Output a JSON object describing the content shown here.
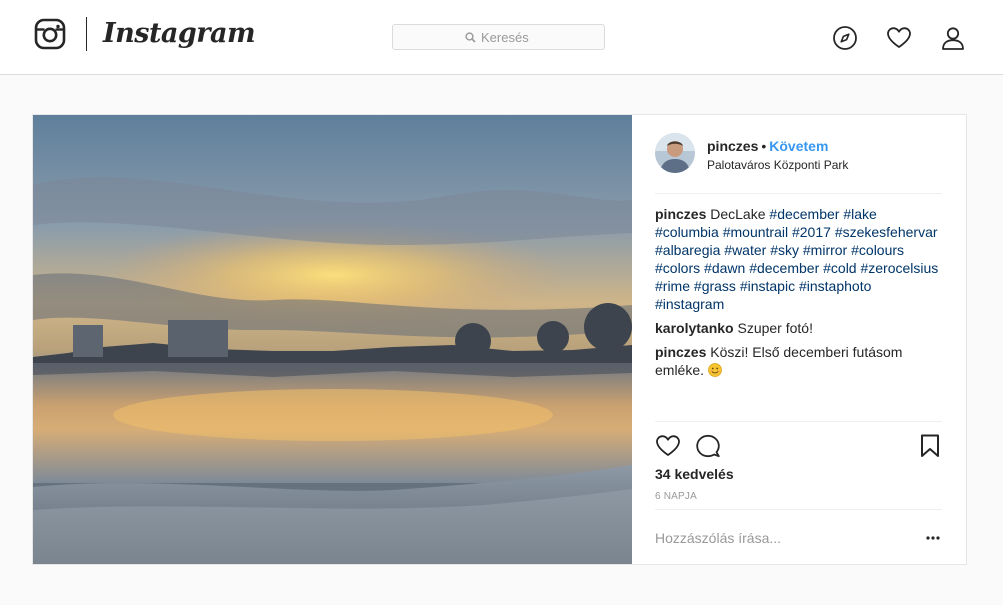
{
  "header": {
    "wordmark": "Instagram",
    "search": {
      "placeholder": "Keresés",
      "value": ""
    },
    "icons": [
      "instagram-glyph-icon",
      "compass-icon",
      "heart-icon",
      "user-icon"
    ]
  },
  "post": {
    "owner": {
      "username": "pinczes",
      "separator": "•",
      "follow_label": "Követem",
      "location": "Palotaváros Központi Park"
    },
    "caption": {
      "user": "pinczes",
      "text": "DecLake",
      "hashtags": [
        "#december",
        "#lake",
        "#columbia",
        "#mountrail",
        "#2017",
        "#szekesfehervar",
        "#albaregia",
        "#water",
        "#sky",
        "#mirror",
        "#colours",
        "#colors",
        "#dawn",
        "#december",
        "#cold",
        "#zerocelsius",
        "#rime",
        "#grass",
        "#instapic",
        "#instaphoto",
        "#instagram"
      ]
    },
    "comments": [
      {
        "user": "karolytanko",
        "text": "Szuper fotó!"
      },
      {
        "user": "pinczes",
        "text": "Köszi! Első decemberi futásom emléke.",
        "emoji": "smiling-face-icon"
      }
    ],
    "likes_label": "34 kedvelés",
    "time_label": "6 NAPJA",
    "add_comment_placeholder": "Hozzászólás írása..."
  },
  "colors": {
    "link": "#3897f0",
    "hashtag": "#003569",
    "border": "#dbdbdb",
    "background": "#fafafa",
    "muted": "#999999"
  }
}
